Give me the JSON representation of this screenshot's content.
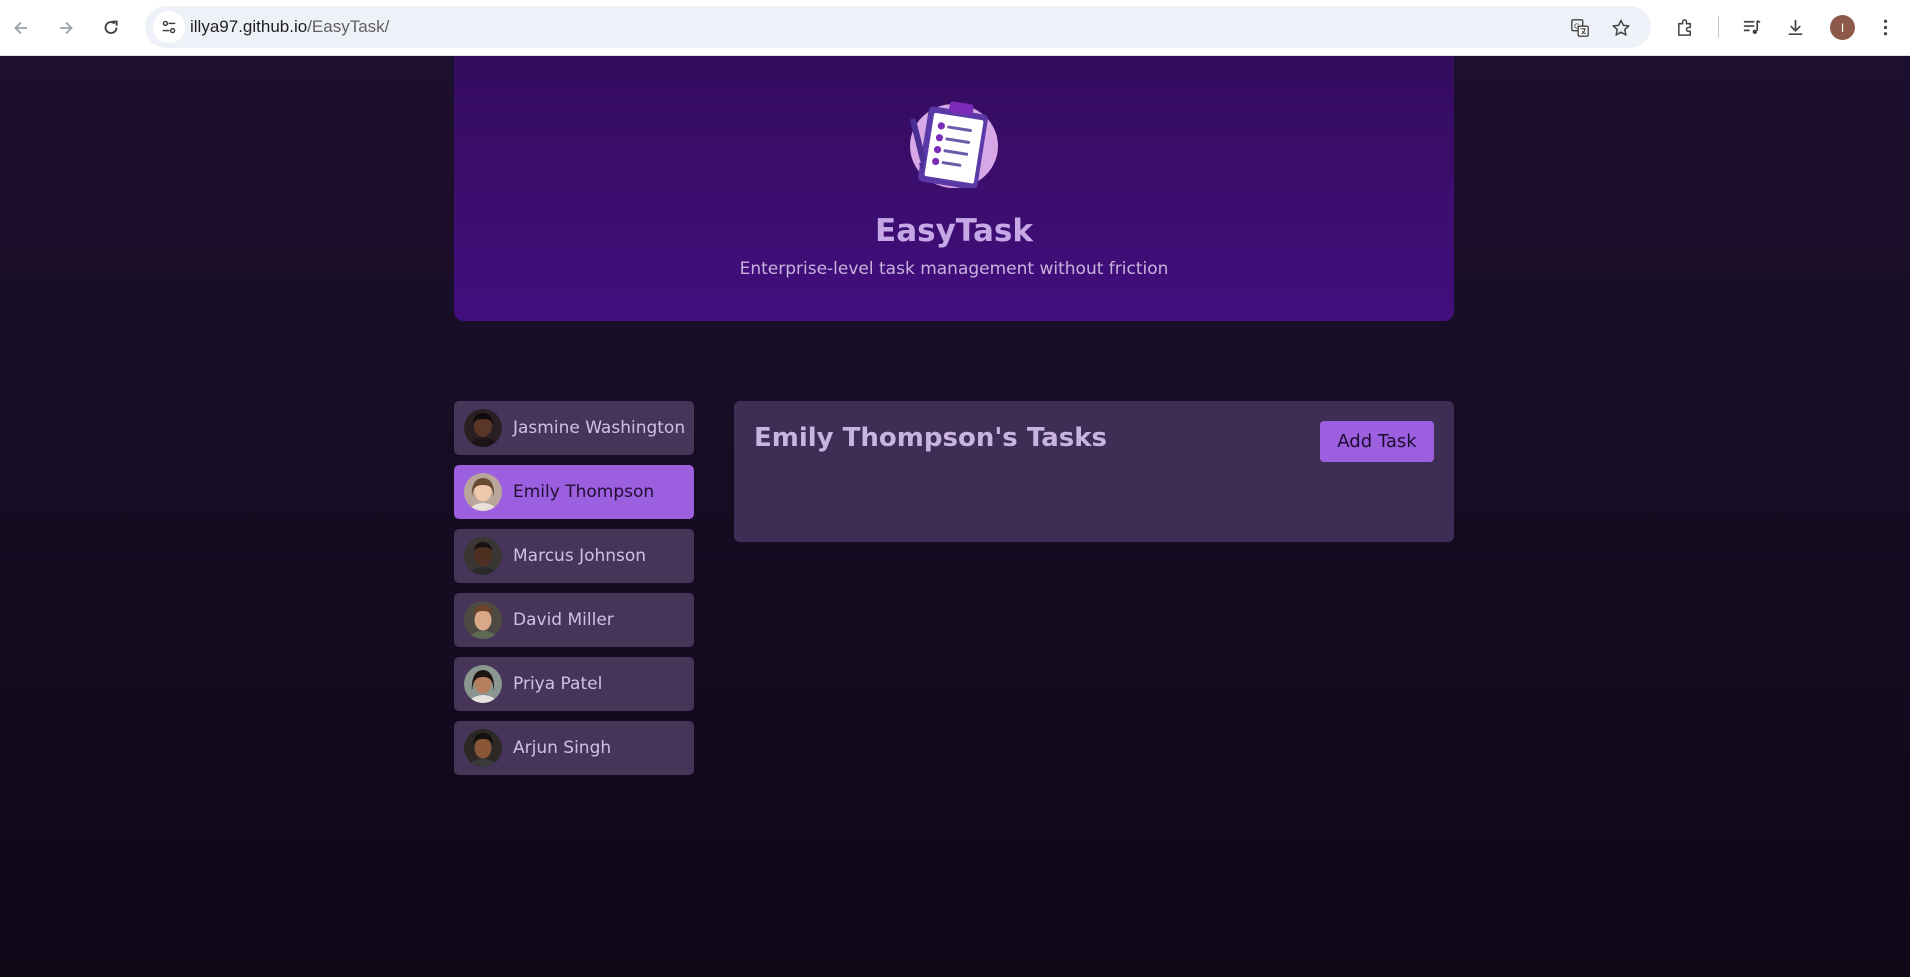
{
  "browser": {
    "url_host": "illya97.github.io",
    "url_path": "/EasyTask/",
    "profile_initial": "I"
  },
  "header": {
    "title": "EasyTask",
    "tagline": "Enterprise-level task management without friction",
    "logo_icon": "clipboard-checklist-icon"
  },
  "users": [
    {
      "name": "Jasmine Washington",
      "selected": false
    },
    {
      "name": "Emily Thompson",
      "selected": true
    },
    {
      "name": "Marcus Johnson",
      "selected": false
    },
    {
      "name": "David Miller",
      "selected": false
    },
    {
      "name": "Priya Patel",
      "selected": false
    },
    {
      "name": "Arjun Singh",
      "selected": false
    }
  ],
  "tasks": {
    "title": "Emily Thompson's Tasks",
    "add_button_label": "Add Task"
  },
  "colors": {
    "accent": "#9c5fe0",
    "header_bg": "#3e0e72",
    "panel_bg": "#3e2d55",
    "page_bg": "#150c22"
  }
}
